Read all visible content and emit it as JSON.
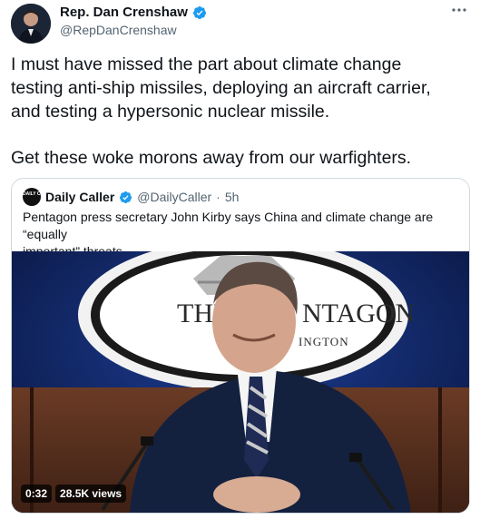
{
  "author": {
    "name": "Rep. Dan Crenshaw",
    "handle": "@RepDanCrenshaw",
    "verified_icon": "verified-badge-icon",
    "avatar_icon": "avatar"
  },
  "tweet": {
    "lines": [
      "I must have missed the part about climate change",
      "testing anti-ship missiles, deploying an aircraft carrier,",
      "and testing a hypersonic nuclear missile.",
      "Get these woke morons away from our warfighters."
    ]
  },
  "quoted": {
    "logo_text": "DAILY CALLER",
    "name": "Daily Caller",
    "handle": "@DailyCaller",
    "separator": "·",
    "time": "5h",
    "text_lines": [
      "Pentagon press secretary John Kirby says China and climate change are “equally",
      "important” threats"
    ],
    "media": {
      "seal_text_left": "THE",
      "seal_text_right": "NTAGON",
      "seal_subtext": "INGTON",
      "duration": "0:32",
      "views": "28.5K views"
    }
  },
  "colors": {
    "verified": "#1d9bf0",
    "secondary_text": "#536471",
    "border": "#cfd9de",
    "backdrop_blue": "#122a6e"
  },
  "icons": {
    "more": "more-options-icon"
  }
}
